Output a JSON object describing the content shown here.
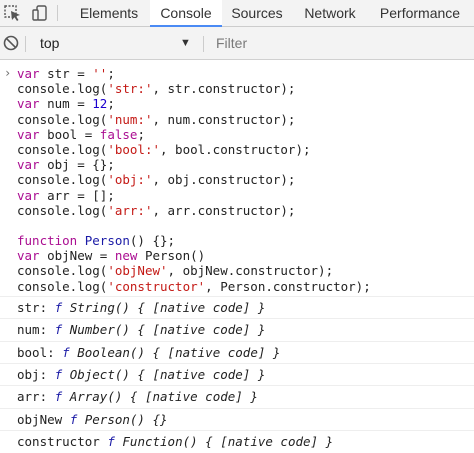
{
  "tabs": [
    {
      "label": "Elements",
      "active": false
    },
    {
      "label": "Console",
      "active": true
    },
    {
      "label": "Sources",
      "active": false
    },
    {
      "label": "Network",
      "active": false
    },
    {
      "label": "Performance",
      "active": false
    }
  ],
  "toolbar": {
    "context": "top",
    "filter_placeholder": "Filter"
  },
  "input_code": [
    [
      {
        "t": "kw",
        "v": "var"
      },
      {
        "t": "p",
        "v": " str = "
      },
      {
        "t": "str",
        "v": "''"
      },
      {
        "t": "p",
        "v": ";"
      }
    ],
    [
      {
        "t": "p",
        "v": "console.log("
      },
      {
        "t": "str",
        "v": "'str:'"
      },
      {
        "t": "p",
        "v": ", str.constructor);"
      }
    ],
    [
      {
        "t": "kw",
        "v": "var"
      },
      {
        "t": "p",
        "v": " num = "
      },
      {
        "t": "num",
        "v": "12"
      },
      {
        "t": "p",
        "v": ";"
      }
    ],
    [
      {
        "t": "p",
        "v": "console.log("
      },
      {
        "t": "str",
        "v": "'num:'"
      },
      {
        "t": "p",
        "v": ", num.constructor);"
      }
    ],
    [
      {
        "t": "kw",
        "v": "var"
      },
      {
        "t": "p",
        "v": " bool = "
      },
      {
        "t": "kw",
        "v": "false"
      },
      {
        "t": "p",
        "v": ";"
      }
    ],
    [
      {
        "t": "p",
        "v": "console.log("
      },
      {
        "t": "str",
        "v": "'bool:'"
      },
      {
        "t": "p",
        "v": ", bool.constructor);"
      }
    ],
    [
      {
        "t": "kw",
        "v": "var"
      },
      {
        "t": "p",
        "v": " obj = {};"
      }
    ],
    [
      {
        "t": "p",
        "v": "console.log("
      },
      {
        "t": "str",
        "v": "'obj:'"
      },
      {
        "t": "p",
        "v": ", obj.constructor);"
      }
    ],
    [
      {
        "t": "kw",
        "v": "var"
      },
      {
        "t": "p",
        "v": " arr = [];"
      }
    ],
    [
      {
        "t": "p",
        "v": "console.log("
      },
      {
        "t": "str",
        "v": "'arr:'"
      },
      {
        "t": "p",
        "v": ", arr.constructor);"
      }
    ],
    [
      {
        "t": "p",
        "v": ""
      }
    ],
    [
      {
        "t": "kw",
        "v": "function"
      },
      {
        "t": "p",
        "v": " "
      },
      {
        "t": "fn",
        "v": "Person"
      },
      {
        "t": "p",
        "v": "() {};"
      }
    ],
    [
      {
        "t": "kw",
        "v": "var"
      },
      {
        "t": "p",
        "v": " objNew = "
      },
      {
        "t": "kw",
        "v": "new"
      },
      {
        "t": "p",
        "v": " Person()"
      }
    ],
    [
      {
        "t": "p",
        "v": "console.log("
      },
      {
        "t": "str",
        "v": "'objNew'"
      },
      {
        "t": "p",
        "v": ", objNew.constructor);"
      }
    ],
    [
      {
        "t": "p",
        "v": "console.log("
      },
      {
        "t": "str",
        "v": "'constructor'"
      },
      {
        "t": "p",
        "v": ", Person.constructor);"
      }
    ]
  ],
  "log_rows": [
    {
      "label": "str:",
      "sig": "String() { [native code] }"
    },
    {
      "label": "num:",
      "sig": "Number() { [native code] }"
    },
    {
      "label": "bool:",
      "sig": "Boolean() { [native code] }"
    },
    {
      "label": "obj:",
      "sig": "Object() { [native code] }"
    },
    {
      "label": "arr:",
      "sig": "Array() { [native code] }"
    },
    {
      "label": "objNew",
      "sig": "Person() {}"
    },
    {
      "label": "constructor",
      "sig": "Function() { [native code] }"
    }
  ],
  "function_marker": "f",
  "prompt_symbol": "›",
  "dropdown_symbol": "▼",
  "colors": {
    "keyword": "#aa0d91",
    "string": "#c41a16",
    "number": "#1c00cf",
    "function_marker": "#1a1aa6",
    "active_tab_underline": "#4a8af4"
  }
}
